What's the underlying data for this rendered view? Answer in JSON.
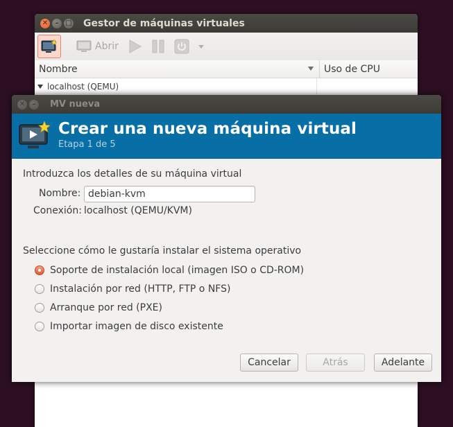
{
  "manager": {
    "title": "Gestor de máquinas virtuales",
    "toolbar": {
      "open_label": "Abrir"
    },
    "table": {
      "columns": [
        "Nombre",
        "Uso de CPU"
      ],
      "rows": [
        {
          "name": "localhost (QEMU)",
          "cpu": ""
        }
      ]
    }
  },
  "dialog": {
    "window_title": "MV nueva",
    "header_title": "Crear una nueva máquina virtual",
    "step": "Etapa 1 de 5",
    "details_label": "Introduzca los detalles de su máquina virtual",
    "name_label": "Nombre:",
    "name_value": "debian-kvm",
    "connection_label": "Conexión:",
    "connection_value": "localhost (QEMU/KVM)",
    "install_label": "Seleccione cómo le gustaría instalar el sistema operativo",
    "options": [
      {
        "label": "Soporte de instalación local (imagen ISO o CD-ROM)",
        "checked": true
      },
      {
        "label": "Instalación por red (HTTP, FTP o NFS)",
        "checked": false
      },
      {
        "label": "Arranque por red (PXE)",
        "checked": false
      },
      {
        "label": "Importar imagen de disco existente",
        "checked": false
      }
    ],
    "buttons": {
      "cancel": "Cancelar",
      "back": "Atrás",
      "forward": "Adelante"
    }
  },
  "colors": {
    "header_bg": "#086ea6",
    "accent": "#e1562c",
    "desktop_bg": "#2c0f22"
  }
}
